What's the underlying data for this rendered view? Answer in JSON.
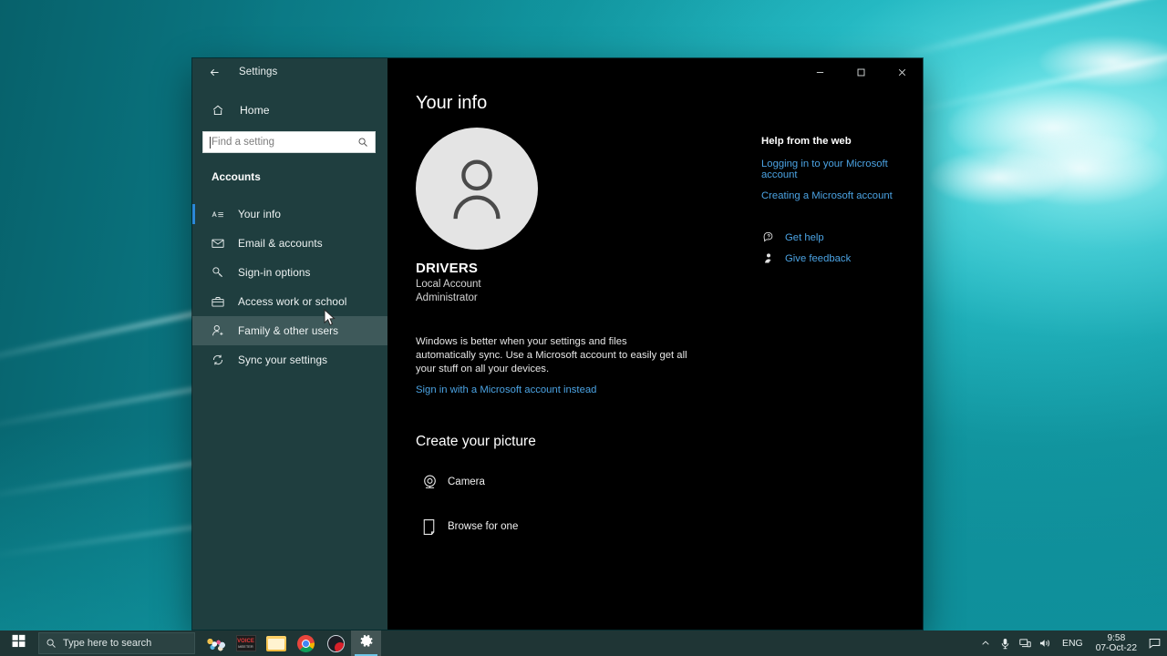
{
  "window": {
    "titlebar_title": "Settings",
    "back_icon": "back-arrow-icon",
    "minimize_label": "–",
    "maximize_label": "□",
    "close_label": "✕"
  },
  "sidebar": {
    "home_label": "Home",
    "home_icon": "home-icon",
    "search": {
      "placeholder": "Find a setting",
      "value": "",
      "icon": "search-icon"
    },
    "section_title": "Accounts",
    "items": [
      {
        "label": "Your info",
        "icon": "account-info-icon",
        "state": "selected"
      },
      {
        "label": "Email & accounts",
        "icon": "envelope-icon",
        "state": "normal"
      },
      {
        "label": "Sign-in options",
        "icon": "key-icon",
        "state": "normal"
      },
      {
        "label": "Access work or school",
        "icon": "briefcase-icon",
        "state": "normal"
      },
      {
        "label": "Family & other users",
        "icon": "add-person-icon",
        "state": "hovered"
      },
      {
        "label": "Sync your settings",
        "icon": "sync-icon",
        "state": "normal"
      }
    ]
  },
  "main": {
    "page_title": "Your info",
    "avatar_icon": "person-avatar-icon",
    "account_name": "DRIVERS",
    "account_type": "Local Account",
    "account_role": "Administrator",
    "sync_paragraph": "Windows is better when your settings and files automatically sync. Use a Microsoft account to easily get all your stuff on all your devices.",
    "sync_link": "Sign in with a Microsoft account instead",
    "create_picture_heading": "Create your picture",
    "picture_options": [
      {
        "label": "Camera",
        "icon": "camera-icon"
      },
      {
        "label": "Browse for one",
        "icon": "browse-file-icon"
      }
    ]
  },
  "help": {
    "title": "Help from the web",
    "links": [
      "Logging in to your Microsoft account",
      "Creating a Microsoft account"
    ],
    "actions": [
      {
        "label": "Get help",
        "icon": "get-help-icon"
      },
      {
        "label": "Give feedback",
        "icon": "feedback-icon"
      }
    ]
  },
  "taskbar": {
    "start_icon": "windows-start-icon",
    "search_placeholder": "Type here to search",
    "search_icon": "search-icon",
    "apps": [
      {
        "name": "cortana",
        "icon": "cortana-icon"
      },
      {
        "name": "voicemeeter",
        "icon": "voicemeeter-icon",
        "line1": "VOICE",
        "line2": "MEETER"
      },
      {
        "name": "file-explorer",
        "icon": "file-explorer-icon"
      },
      {
        "name": "chrome",
        "icon": "chrome-icon"
      },
      {
        "name": "media-player",
        "icon": "media-player-icon"
      },
      {
        "name": "settings",
        "icon": "gear-icon",
        "state": "active"
      }
    ],
    "tray": {
      "show_hidden_icon": "chevron-up-icon",
      "microphone_icon": "microphone-icon",
      "network_icon": "network-icon",
      "volume_icon": "volume-icon",
      "language": "ENG",
      "time": "9:58",
      "date": "07-Oct-22",
      "notification_icon": "notification-icon"
    }
  },
  "colors": {
    "accent": "#2b88d8",
    "link": "#4ba3e3",
    "sidebar_bg": "#1f3e3f",
    "content_bg": "#000000",
    "taskbar_bg": "#1f3535",
    "wallpaper": "#13949e"
  }
}
